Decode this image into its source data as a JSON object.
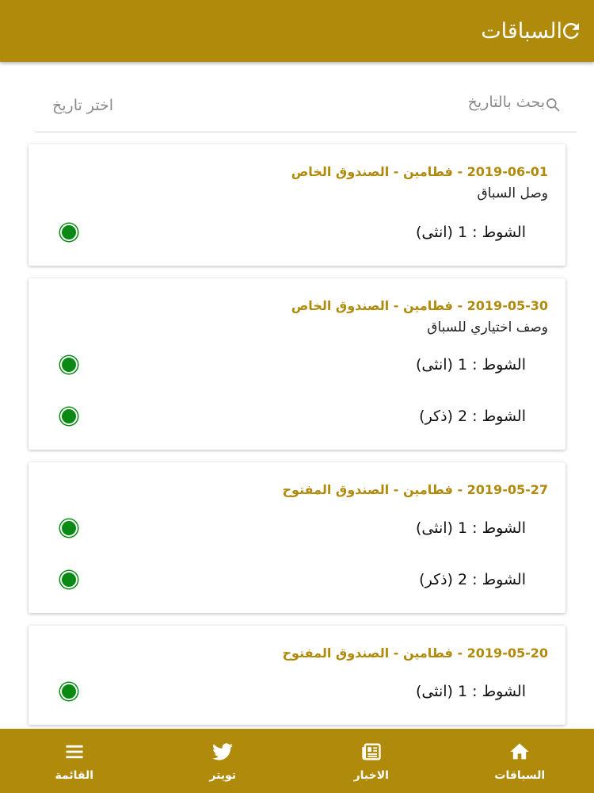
{
  "app_bar": {
    "title": "السباقات"
  },
  "search": {
    "placeholder": "بحث بالتاريخ",
    "date_picker_label": "اختر تاريخ"
  },
  "races": [
    {
      "title": "2019-06-01 - فطامين - الصندوق الخاص",
      "description": "وصل السباق",
      "heats": [
        {
          "label": "الشوط : 1 (انثى)"
        }
      ]
    },
    {
      "title": "2019-05-30 - فطامين - الصندوق الخاص",
      "description": "وصف اختياري للسباق",
      "heats": [
        {
          "label": "الشوط : 1 (انثى)"
        },
        {
          "label": "الشوط : 2 (ذكر)"
        }
      ]
    },
    {
      "title": "2019-05-27 - فطامين - الصندوق المفتوح",
      "description": "",
      "heats": [
        {
          "label": "الشوط : 1 (انثى)"
        },
        {
          "label": "الشوط : 2 (ذكر)"
        }
      ]
    },
    {
      "title": "2019-05-20 - فطامين - الصندوق المفتوح",
      "description": "",
      "heats": [
        {
          "label": "الشوط : 1 (انثى)"
        }
      ]
    }
  ],
  "bottom_nav": {
    "items": [
      {
        "label": "السباقات",
        "icon": "home-icon"
      },
      {
        "label": "الاخبار",
        "icon": "newspaper-icon"
      },
      {
        "label": "تويتر",
        "icon": "twitter-icon"
      },
      {
        "label": "القائمة",
        "icon": "menu-icon"
      }
    ]
  },
  "colors": {
    "primary": "#b08a0a",
    "status_dot": "#0a8a14"
  }
}
